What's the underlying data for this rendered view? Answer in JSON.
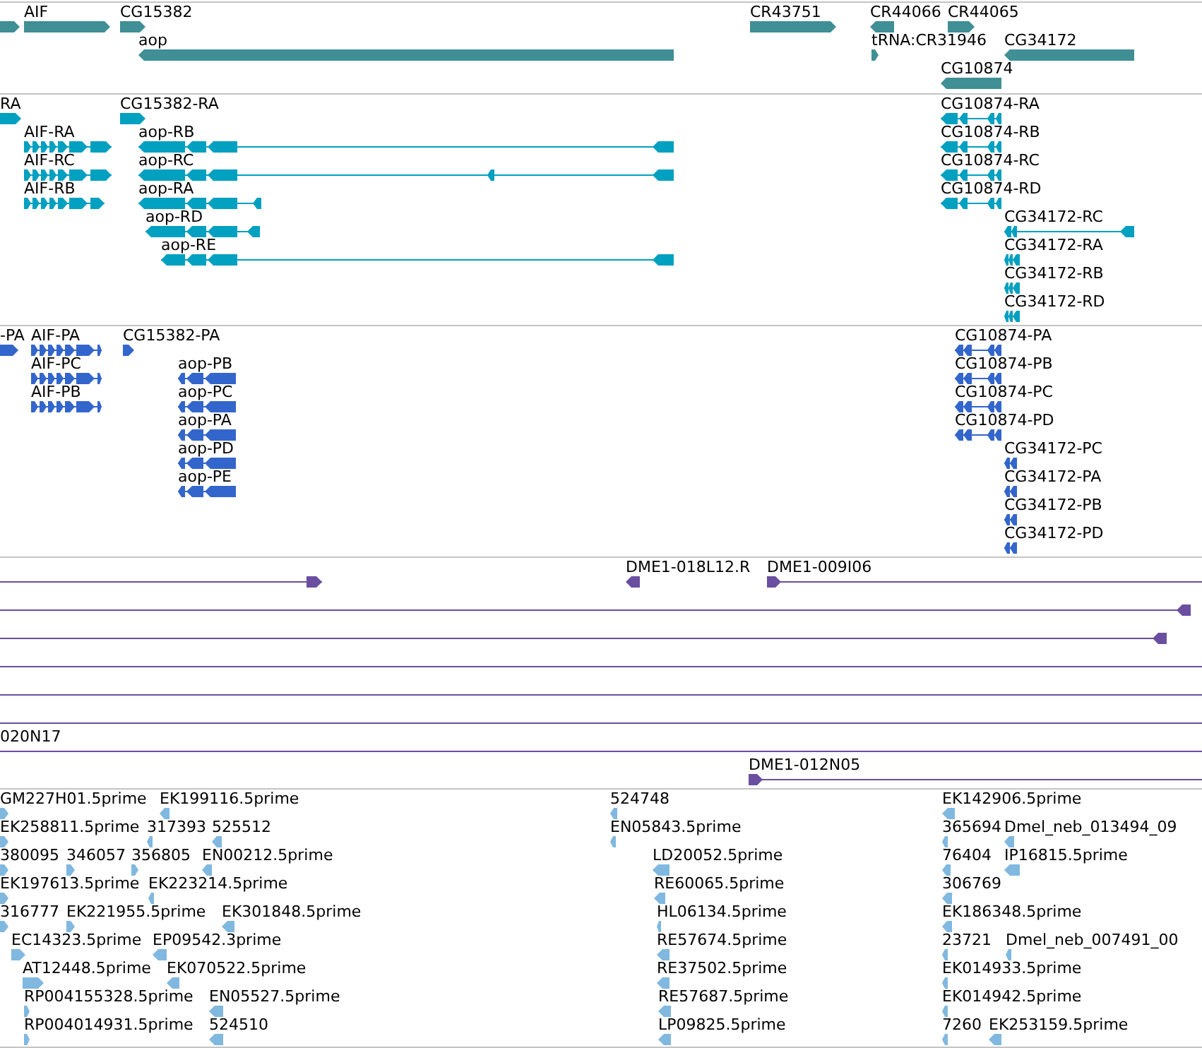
{
  "tracks": [
    {
      "color": "#3f8f94",
      "features": [
        {
          "reverse": false
        },
        {
          "label": "AIF",
          "reverse": false
        },
        {
          "label": "CG15382",
          "reverse": false
        },
        {
          "label": "aop",
          "reverse": true
        },
        {
          "label": "CR43751",
          "reverse": false
        },
        {
          "label": "CR44066",
          "reverse": true
        },
        {
          "label": "CR44065",
          "reverse": false
        },
        {
          "label": "tRNA:CR31946",
          "reverse": false
        },
        {
          "label": "CG34172",
          "reverse": true
        },
        {
          "label": "CG10874",
          "reverse": true
        }
      ]
    },
    {
      "color": "#00a0c0",
      "features": [
        {
          "label": "RA",
          "reverse": false
        },
        {
          "label": "CG15382-RA",
          "reverse": false
        },
        {
          "label": "AIF-RA",
          "reverse": false
        },
        {
          "label": "AIF-RC",
          "reverse": false
        },
        {
          "label": "AIF-RB",
          "reverse": false
        },
        {
          "label": "aop-RB",
          "reverse": true
        },
        {
          "label": "aop-RC",
          "reverse": true
        },
        {
          "label": "aop-RA",
          "reverse": true
        },
        {
          "label": "aop-RD",
          "reverse": true
        },
        {
          "label": "aop-RE",
          "reverse": true
        },
        {
          "label": "CG10874-RA",
          "reverse": true
        },
        {
          "label": "CG10874-RB",
          "reverse": true
        },
        {
          "label": "CG10874-RC",
          "reverse": true
        },
        {
          "label": "CG10874-RD",
          "reverse": true
        },
        {
          "label": "CG34172-RC",
          "reverse": true
        },
        {
          "label": "CG34172-RA",
          "reverse": true
        },
        {
          "label": "CG34172-RB",
          "reverse": true
        },
        {
          "label": "CG34172-RD",
          "reverse": true
        }
      ]
    },
    {
      "color": "#3366cc",
      "features": [
        {
          "label": "-PA",
          "reverse": false
        },
        {
          "label": "AIF-PA",
          "reverse": false
        },
        {
          "label": "AIF-PC",
          "reverse": false
        },
        {
          "label": "AIF-PB",
          "reverse": false
        },
        {
          "label": "CG15382-PA",
          "reverse": false
        },
        {
          "label": "CG10874-PA",
          "reverse": true
        },
        {
          "label": "CG10874-PB",
          "reverse": true
        },
        {
          "label": "CG10874-PC",
          "reverse": true
        },
        {
          "label": "CG10874-PD",
          "reverse": true
        },
        {
          "label": "aop-PB",
          "reverse": true
        },
        {
          "label": "aop-PC",
          "reverse": true
        },
        {
          "label": "aop-PA",
          "reverse": true
        },
        {
          "label": "aop-PD",
          "reverse": true
        },
        {
          "label": "aop-PE",
          "reverse": true
        },
        {
          "label": "CG34172-PC",
          "reverse": true
        },
        {
          "label": "CG34172-PA",
          "reverse": true
        },
        {
          "label": "CG34172-PB",
          "reverse": true
        },
        {
          "label": "CG34172-PD",
          "reverse": true
        }
      ]
    },
    {
      "color": "#6a4fa0",
      "features": [
        {
          "kind": "span",
          "reverse": false
        },
        {
          "kind": "span",
          "label": "DME1-018L12.R",
          "reverse": true
        },
        {
          "kind": "span",
          "label": "DME1-009I06",
          "reverse": false
        },
        {
          "kind": "span",
          "reverse": true
        },
        {
          "kind": "span",
          "reverse": true
        },
        {
          "kind": "line"
        },
        {
          "kind": "line"
        },
        {
          "kind": "line"
        },
        {
          "kind": "line",
          "label": "020N17"
        },
        {
          "kind": "span",
          "label": "DME1-012N05",
          "reverse": false
        }
      ]
    },
    {
      "color": "#80b8e0",
      "features": [
        {
          "label": "GM227H01.5prime",
          "reverse": false
        },
        {
          "label": "EK199116.5prime",
          "reverse": true
        },
        {
          "label": "524748",
          "reverse": true
        },
        {
          "label": "EK142906.5prime",
          "reverse": true
        },
        {
          "label": "EK258811.5prime",
          "reverse": false
        },
        {
          "label": "317393",
          "reverse": true
        },
        {
          "label": "525512",
          "reverse": true
        },
        {
          "label": "EN05843.5prime",
          "reverse": true
        },
        {
          "label": "365694",
          "reverse": true
        },
        {
          "label": "Dmel_neb_013494_09",
          "reverse": true
        },
        {
          "label": "380095",
          "reverse": false
        },
        {
          "label": "346057",
          "reverse": false
        },
        {
          "label": "356805",
          "reverse": false
        },
        {
          "label": "EN00212.5prime",
          "reverse": true
        },
        {
          "label": "LD20052.5prime",
          "reverse": true
        },
        {
          "label": "76404",
          "reverse": true
        },
        {
          "label": "IP16815.5prime",
          "reverse": true
        },
        {
          "label": "EK197613.5prime",
          "reverse": false
        },
        {
          "label": "EK223214.5prime",
          "reverse": true
        },
        {
          "label": "RE60065.5prime",
          "reverse": true
        },
        {
          "label": "306769",
          "reverse": true
        },
        {
          "label": "316777",
          "reverse": false
        },
        {
          "label": "EK221955.5prime",
          "reverse": false
        },
        {
          "label": "EK301848.5prime",
          "reverse": true
        },
        {
          "label": "HL06134.5prime",
          "reverse": true
        },
        {
          "label": "EK186348.5prime",
          "reverse": true
        },
        {
          "label": "EC14323.5prime",
          "reverse": false
        },
        {
          "label": "EP09542.3prime",
          "reverse": true
        },
        {
          "label": "RE57674.5prime",
          "reverse": true
        },
        {
          "label": "23721",
          "reverse": true
        },
        {
          "label": "Dmel_neb_007491_00",
          "reverse": true
        },
        {
          "label": "AT12448.5prime",
          "reverse": false
        },
        {
          "label": "EK070522.5prime",
          "reverse": true
        },
        {
          "label": "RE37502.5prime",
          "reverse": true
        },
        {
          "label": "EK014933.5prime",
          "reverse": true
        },
        {
          "label": "RP004155328.5prime",
          "reverse": false
        },
        {
          "label": "EN05527.5prime",
          "reverse": true
        },
        {
          "label": "RE57687.5prime",
          "reverse": true
        },
        {
          "label": "EK014942.5prime",
          "reverse": true
        },
        {
          "label": "RP004014931.5prime",
          "reverse": false
        },
        {
          "label": "524510",
          "reverse": true
        },
        {
          "label": "LP09825.5prime",
          "reverse": true
        },
        {
          "label": "7260",
          "reverse": true
        },
        {
          "label": "EK253159.5prime",
          "reverse": true
        }
      ]
    }
  ]
}
